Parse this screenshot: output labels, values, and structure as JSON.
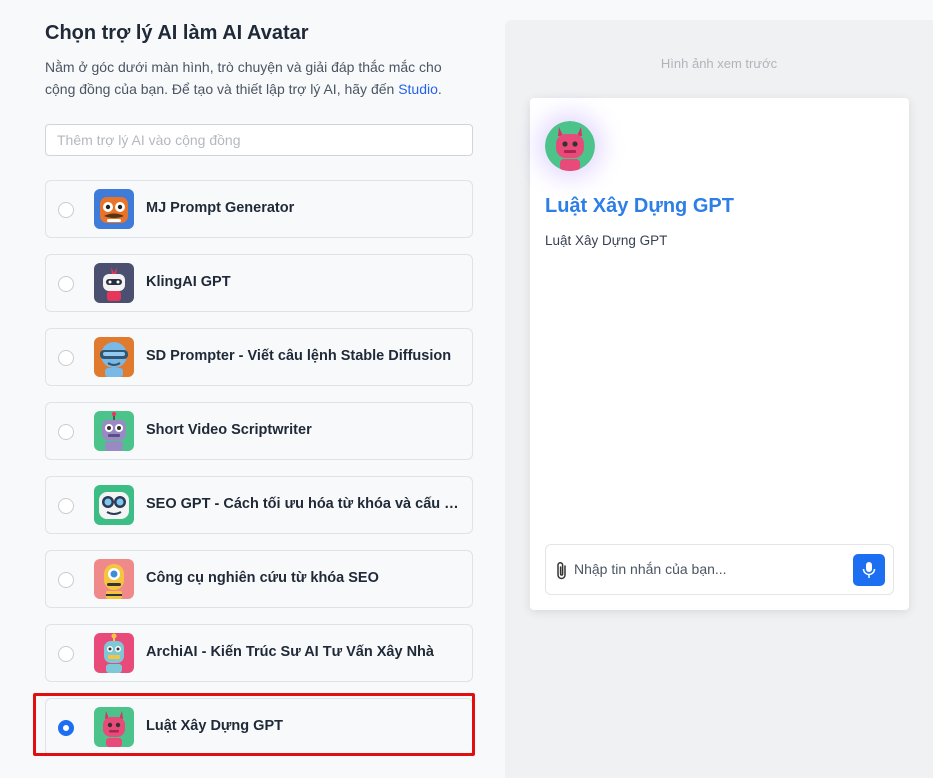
{
  "left": {
    "title": "Chọn trợ lý AI làm AI Avatar",
    "description_part1": "Nằm ở góc dưới màn hình, trò chuyện và giải đáp thắc mắc cho cộng đồng của bạn. Để tạo và thiết lập trợ lý AI, hãy đến ",
    "studio_link": "Studio",
    "description_end": ".",
    "search_placeholder": "Thêm trợ lý AI vào cộng đồng",
    "assistants": [
      {
        "label": "MJ Prompt Generator",
        "selected": false,
        "icon": "orange-robot-mustache-icon"
      },
      {
        "label": "KlingAI GPT",
        "selected": false,
        "icon": "white-robot-mohawk-icon"
      },
      {
        "label": "SD Prompter - Viết câu lệnh Stable Diffusion",
        "selected": false,
        "icon": "blue-robot-visor-icon"
      },
      {
        "label": "Short Video Scriptwriter",
        "selected": false,
        "icon": "purple-robot-antenna-icon"
      },
      {
        "label": "SEO GPT - Cách tối ưu hóa từ khóa và cấu trúc",
        "selected": false,
        "icon": "white-robot-goggles-icon"
      },
      {
        "label": "Công cụ nghiên cứu từ khóa SEO",
        "selected": false,
        "icon": "yellow-robot-cyclops-icon"
      },
      {
        "label": "ArchiAI - Kiến Trúc Sư AI Tư Vấn Xây Nhà",
        "selected": false,
        "icon": "pink-robot-antenna-icon"
      },
      {
        "label": "Luật Xây Dựng GPT",
        "selected": true,
        "icon": "pink-robot-horns-icon"
      }
    ]
  },
  "preview": {
    "caption": "Hình ảnh xem trước",
    "name": "Luật Xây Dựng GPT",
    "description": "Luật Xây Dựng GPT",
    "input_placeholder": "Nhập tin nhắn của bạn..."
  },
  "colors": {
    "accent": "#1d6ff2",
    "preview_name": "#2d7ee6",
    "highlight": "#e01010"
  }
}
